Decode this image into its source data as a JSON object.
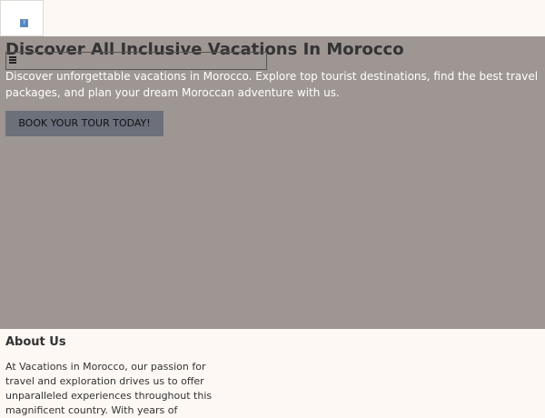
{
  "header": {
    "logo_icon": "help-icon",
    "logo_glyph": "?"
  },
  "hero": {
    "title": "Discover All Inclusive Vacations In Morocco",
    "menu_icon": "hamburger-menu-icon",
    "description": "Discover unforgettable vacations in Morocco. Explore top tourist destinations, find the best travel packages, and plan your dream Moroccan adventure with us.",
    "cta_label": "BOOK YOUR TOUR TODAY!",
    "colors": {
      "overlay": "#9e9693",
      "button": "#6b707b",
      "description_text": "#ffffff"
    }
  },
  "about": {
    "heading": "About Us",
    "text": "At Vacations in Morocco, our passion for travel and exploration drives us to offer unparalleled experiences throughout this magnificent country. With years of"
  }
}
